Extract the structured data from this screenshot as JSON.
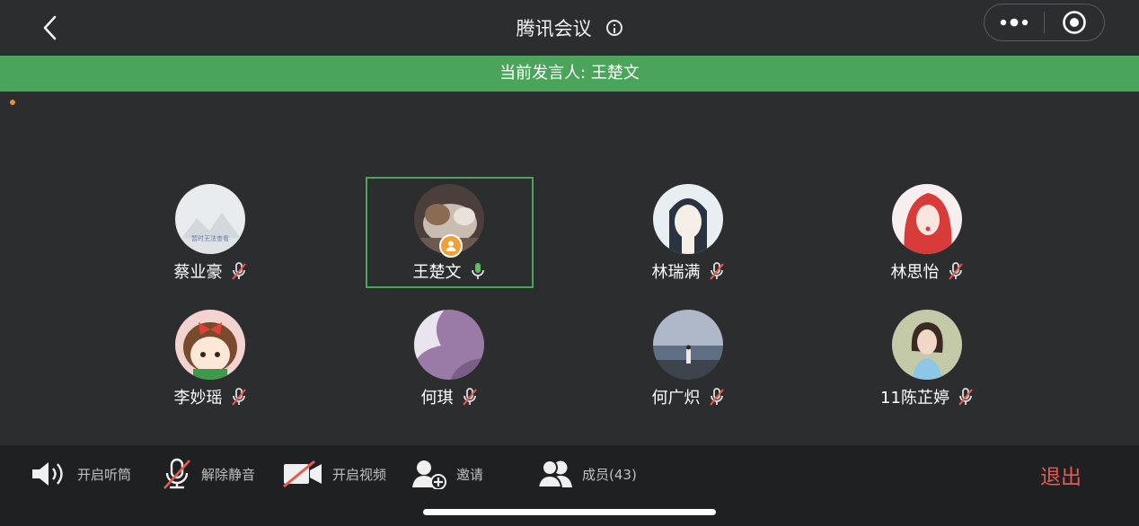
{
  "header": {
    "title": "腾讯会议",
    "back_icon": "chevron-left-icon",
    "info_icon": "info-icon",
    "more_icon": "more-dots-icon",
    "close_icon": "target-circle-icon"
  },
  "speaker_bar": {
    "text": "当前发言人: 王楚文",
    "color": "#4aa55a"
  },
  "participants": [
    {
      "name": "蔡业豪",
      "mic": "muted",
      "avatar": "placeholder-mountain",
      "avatar_text": "暂时无法查看"
    },
    {
      "name": "王楚文",
      "mic": "active",
      "avatar": "dog-photo",
      "host": true,
      "speaking": true
    },
    {
      "name": "林瑞满",
      "mic": "muted",
      "avatar": "anime-boy"
    },
    {
      "name": "林思怡",
      "mic": "muted",
      "avatar": "red-hair-girl"
    },
    {
      "name": "李妙瑶",
      "mic": "muted",
      "avatar": "cartoon-girl"
    },
    {
      "name": "何琪",
      "mic": "muted",
      "avatar": "purple-abstract"
    },
    {
      "name": "何广炽",
      "mic": "muted",
      "avatar": "beach-photo"
    },
    {
      "name": "11陈芷婷",
      "mic": "muted",
      "avatar": "girl-photo"
    }
  ],
  "toolbar": {
    "speaker_label": "开启听筒",
    "unmute_label": "解除静音",
    "video_label": "开启视频",
    "invite_label": "邀请",
    "members_label": "成员(43)",
    "exit_label": "退出"
  },
  "colors": {
    "accent": "#4aa55a",
    "exit": "#e85a4f",
    "host_badge": "#f0a03a"
  }
}
